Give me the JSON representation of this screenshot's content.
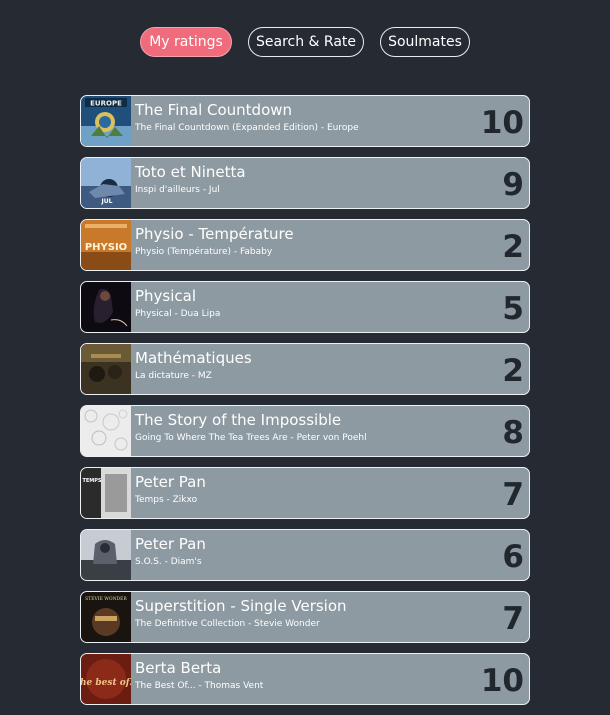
{
  "nav": {
    "tabs": [
      {
        "label": "My ratings",
        "active": true
      },
      {
        "label": "Search & Rate",
        "active": false
      },
      {
        "label": "Soulmates",
        "active": false
      }
    ]
  },
  "ratings": [
    {
      "title": "The Final Countdown",
      "subtitle": "The Final Countdown (Expanded Edition) - Europe",
      "rating": "10",
      "cover_text": "EUROPE"
    },
    {
      "title": "Toto et Ninetta",
      "subtitle": "Inspi d'ailleurs - Jul",
      "rating": "9",
      "cover_text": "JUL"
    },
    {
      "title": "Physio - Température",
      "subtitle": "Physio (Température) - Fababy",
      "rating": "2",
      "cover_text": "PHYSIO"
    },
    {
      "title": "Physical",
      "subtitle": "Physical - Dua Lipa",
      "rating": "5",
      "cover_text": ""
    },
    {
      "title": "Mathématiques",
      "subtitle": "La dictature - MZ",
      "rating": "2",
      "cover_text": ""
    },
    {
      "title": "The Story of the Impossible",
      "subtitle": "Going To Where The Tea Trees Are - Peter von Poehl",
      "rating": "8",
      "cover_text": ""
    },
    {
      "title": "Peter Pan",
      "subtitle": "Temps - Zikxo",
      "rating": "7",
      "cover_text": "TEMPS"
    },
    {
      "title": "Peter Pan",
      "subtitle": "S.O.S. - Diam's",
      "rating": "6",
      "cover_text": ""
    },
    {
      "title": "Superstition - Single Version",
      "subtitle": "The Definitive Collection - Stevie Wonder",
      "rating": "7",
      "cover_text": "STEVIE WONDER"
    },
    {
      "title": "Berta Berta",
      "subtitle": "The Best Of... - Thomas Vent",
      "rating": "10",
      "cover_text": "The best of..."
    }
  ],
  "colors": {
    "background": "#252a33",
    "accent": "#f06b7c",
    "row_bg": "#8e9aa1",
    "rating_text": "#22262d"
  }
}
